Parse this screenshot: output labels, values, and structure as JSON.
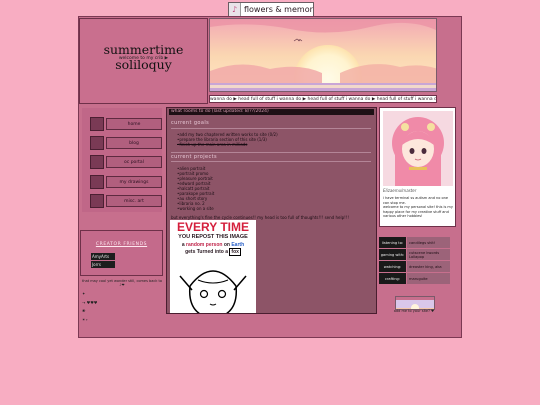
{
  "music": {
    "note_icon": "music-note-icon",
    "song": "flowers & memor"
  },
  "site": {
    "title": "summertime soliloquy",
    "subtitle": "welcome to my crib ▶"
  },
  "marquee": {
    "text": "wanna do ▶ head full of stuff i wanna do ▶ head full of stuff i wanna do ▶ head full of stuff i wanna do ▶ head full of stuff i wanna do ▶ head"
  },
  "nav": {
    "items": [
      {
        "label": "home"
      },
      {
        "label": "blog"
      },
      {
        "label": "oc portal"
      },
      {
        "label": "my drawings"
      },
      {
        "label": "misc. art"
      }
    ]
  },
  "friends": {
    "heading": "CREATOR FRIENDS",
    "buttons": [
      {
        "label": "AmyArts"
      },
      {
        "label": "Jorrs"
      }
    ]
  },
  "stamp": "that may cool yet wonder still, comes back to ♪❤",
  "side_icons": [
    "✦",
    "→  ♥♥♥",
    "❀",
    "✴∘"
  ],
  "main": {
    "header": "what rooms to do (last updated: 8/??/2024)",
    "current_label": "current goals",
    "goals": [
      "add my two chaptered written works to site (0/2)",
      "prepare the libraria section of this site (1/3)",
      "finish up the main area in milliads"
    ],
    "projects_label": "current projects",
    "projects": [
      "alien portrait",
      "portrait promo",
      "pleasure portrait",
      "edward portrait",
      "halcatt portrait",
      "parakope portrait",
      "au short story",
      "libraria no. 2",
      "working on a site"
    ],
    "quote": "but everything's fine the cycle continues!! my head is too full of thoughts!!! send help!!!",
    "meme": {
      "line1": "EVERY TIME",
      "line2": "YOU REPOST THIS IMAGE",
      "line3a": "a",
      "line3b": "random person",
      "line3c": "on",
      "line3d": "Earth",
      "line4": "gets Turned into a",
      "line4b": "fox"
    }
  },
  "profile": {
    "name": "Elizaemulmaster",
    "bio": "i have terminal ss autism and no one can stop me.\nwelcome to my personal site! this is my happy place for my creative stuff and various other hobbies!"
  },
  "status": [
    {
      "key": "listening to:",
      "value": "candilegs shit!"
    },
    {
      "key": "gaming with:",
      "value": "cutscene kwords Lollapop"
    },
    {
      "key": "watching:",
      "value": "dreaster king, aka"
    },
    {
      "key": "crafting:",
      "value": "maruguite"
    }
  ],
  "add": {
    "caption": "add me to your site? ♥"
  },
  "colors": {
    "page_bg": "#f8adc2",
    "frame": "#c76f8d",
    "main": "#8d5467",
    "accent": "#e8c8d6"
  }
}
